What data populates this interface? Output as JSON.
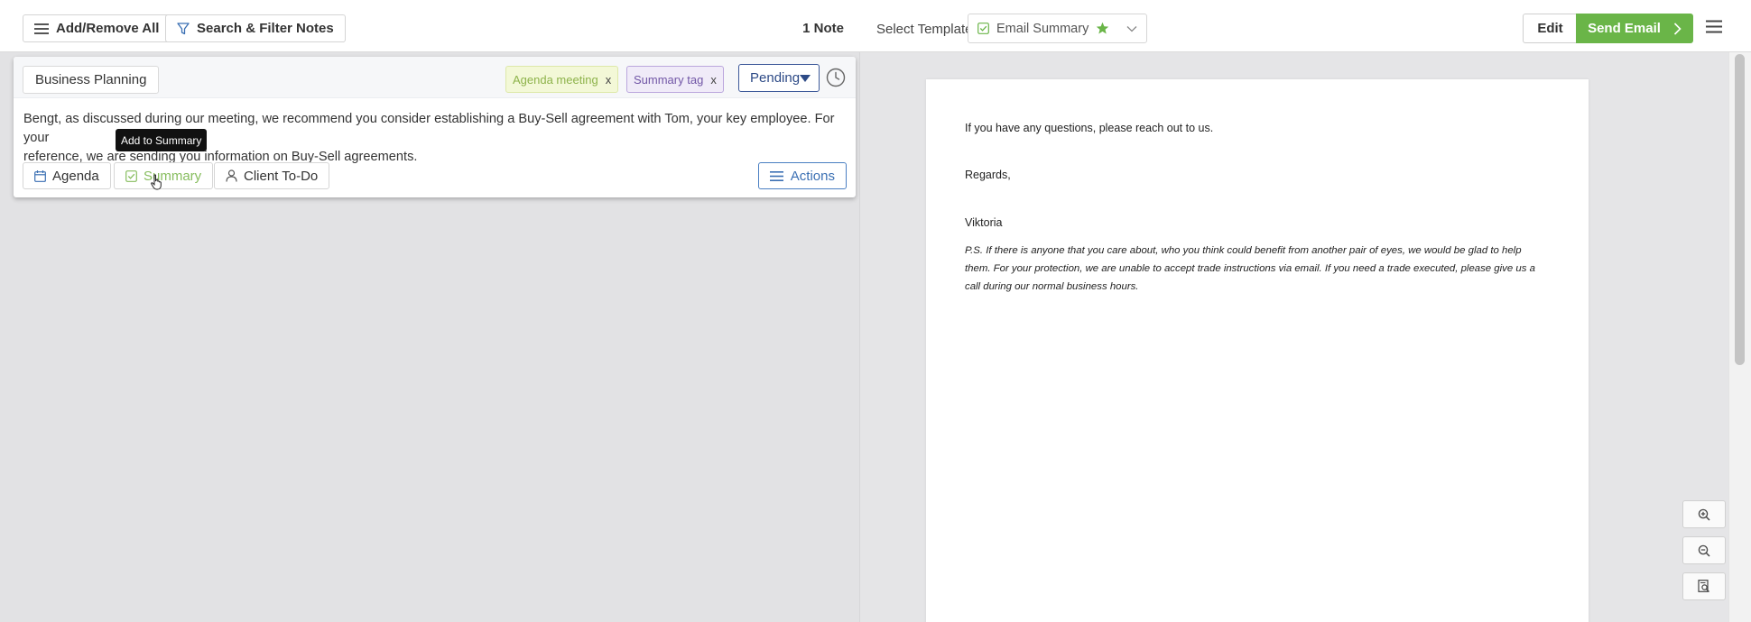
{
  "left_toolbar": {
    "add_remove_label": "Add/Remove All",
    "search_filter_label": "Search & Filter Notes",
    "note_count": "1 Note"
  },
  "note": {
    "category": "Business Planning",
    "tags": [
      {
        "label": "Agenda meeting",
        "remove": "x",
        "color": "#8db24a"
      },
      {
        "label": "Summary tag",
        "remove": "x",
        "color": "#7156a6"
      }
    ],
    "status": "Pending",
    "text_line1": "Bengt, as discussed during our meeting, we recommend you consider establishing a Buy-Sell agreement with Tom, your key employee. For your",
    "text_line2": "reference, we are sending you information on Buy-Sell agreements.",
    "buttons": {
      "agenda": "Agenda",
      "summary": "Summary",
      "client_todo": "Client To-Do",
      "actions": "Actions"
    },
    "tooltip": "Add to Summary"
  },
  "right_toolbar": {
    "select_template_label": "Select Template",
    "template_value": "Email Summary",
    "edit_label": "Edit",
    "send_label": "Send Email"
  },
  "document": {
    "line1": "If you have any questions, please reach out to us.",
    "line2": "Regards,",
    "line3": "Viktoria",
    "ps": "P.S. If there is anyone that you care about, who you think could benefit from another pair of eyes, we would be glad to help them. For your protection, we are unable to accept trade instructions via email. If you need a trade executed, please give us a call during our normal business hours."
  },
  "colors": {
    "accent_green": "#6ab548",
    "accent_blue": "#3a6fb3",
    "status_border": "#3e5a9a"
  },
  "icons": [
    "hamburger-icon",
    "filter-icon",
    "x-icon",
    "caret-down-icon",
    "clock-icon",
    "calendar-icon",
    "check-square-icon",
    "user-icon",
    "list-icon",
    "star-icon",
    "chevron-down-icon",
    "chevron-right-icon",
    "zoom-in-icon",
    "zoom-out-icon",
    "fit-page-icon",
    "hand-cursor-icon"
  ]
}
